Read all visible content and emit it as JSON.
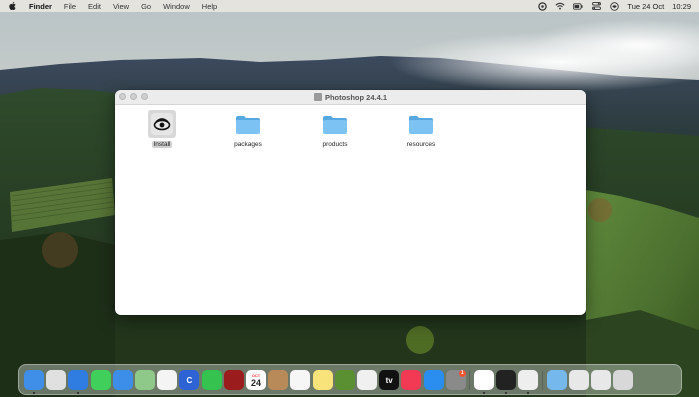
{
  "menubar": {
    "apple_icon": "apple-logo-icon",
    "app_name": "Finder",
    "menus": [
      "File",
      "Edit",
      "View",
      "Go",
      "Window",
      "Help"
    ],
    "status_icons": [
      "creative-cloud-icon",
      "wifi-icon",
      "battery-icon",
      "control-center-icon",
      "siri-icon"
    ],
    "date": "Tue 24 Oct",
    "time": "10:29"
  },
  "window": {
    "title": "Photoshop 24.4.1",
    "items": [
      {
        "label": "Install",
        "icon": "creative-cloud-installer-icon",
        "selected": true
      },
      {
        "label": "packages",
        "icon": "folder-icon",
        "selected": false
      },
      {
        "label": "products",
        "icon": "folder-icon",
        "selected": false
      },
      {
        "label": "resources",
        "icon": "folder-icon",
        "selected": false
      }
    ]
  },
  "dock": {
    "items": [
      {
        "name": "finder-icon",
        "color": "#3f8fe8"
      },
      {
        "name": "launchpad-icon",
        "color": "#e0e0e0"
      },
      {
        "name": "safari-icon",
        "color": "#2f7de0"
      },
      {
        "name": "messages-icon",
        "color": "#3fcf5a"
      },
      {
        "name": "mail-icon",
        "color": "#3d8ee8"
      },
      {
        "name": "maps-icon",
        "color": "#8fc98a"
      },
      {
        "name": "photos-icon",
        "color": "#f4f4f4"
      },
      {
        "name": "c-app-icon",
        "color": "#2e63d6",
        "text": "C"
      },
      {
        "name": "facetime-icon",
        "color": "#35c24e"
      },
      {
        "name": "dictionary-icon",
        "color": "#9b1c1c"
      },
      {
        "name": "calendar-icon",
        "color": "#ffffff",
        "text": "24",
        "month": "OCT"
      },
      {
        "name": "contacts-icon",
        "color": "#b88a5a"
      },
      {
        "name": "reminders-icon",
        "color": "#f6f6f6"
      },
      {
        "name": "notes-icon",
        "color": "#f8e27a"
      },
      {
        "name": "chess-icon",
        "color": "#5a8f32"
      },
      {
        "name": "freeform-icon",
        "color": "#f0f0f0"
      },
      {
        "name": "apple-tv-icon",
        "color": "#111111",
        "text": "tv"
      },
      {
        "name": "music-icon",
        "color": "#f23a55"
      },
      {
        "name": "app-store-icon",
        "color": "#2a8df0"
      },
      {
        "name": "system-settings-icon",
        "color": "#8a8a8a",
        "badge": "1"
      },
      {
        "name": "chrome-icon",
        "color": "#ffffff"
      },
      {
        "name": "terminal-icon",
        "color": "#222222"
      },
      {
        "name": "script-editor-icon",
        "color": "#eeeeee"
      },
      {
        "name": "downloads-folder-icon",
        "color": "#74b8ec"
      },
      {
        "name": "window-thumbnail-icon",
        "color": "#e8e8e8"
      },
      {
        "name": "window-thumbnail-2-icon",
        "color": "#e8e8e8"
      },
      {
        "name": "trash-icon",
        "color": "#d8d8d8"
      }
    ]
  }
}
